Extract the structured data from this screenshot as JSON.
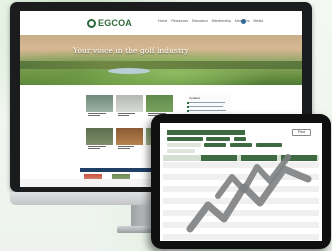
{
  "monitor": {
    "site": {
      "logo_text": "EGCOA",
      "nav_items": [
        "Home",
        "Resources",
        "Education",
        "Membership",
        "Members",
        "Media"
      ],
      "hero_title": "Your voice in the golf industry"
    },
    "sidebar": {
      "title": "Updates"
    }
  },
  "tablet": {
    "print_label": "Print",
    "colors": {
      "accent": "#3d6a40",
      "chart_line": "#7d7f82"
    }
  }
}
